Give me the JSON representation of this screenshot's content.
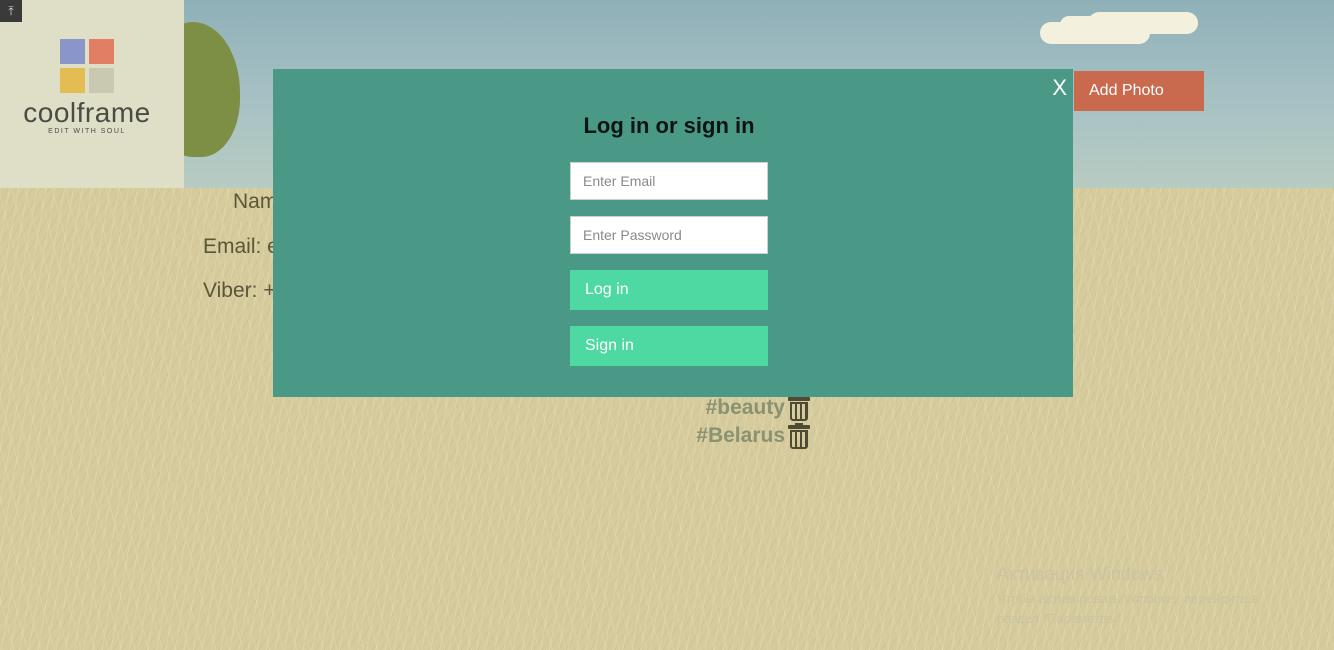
{
  "header": {
    "logo_text": "coolframe",
    "logo_tagline": "EDIT WITH SOUL",
    "upload_icon": "upload-icon",
    "add_photo_label": "Add Photo"
  },
  "profile": {
    "name_label": "Nam",
    "email_label": "Email: e",
    "viber_label": "Viber: +"
  },
  "tags": [
    {
      "text": "#beauty",
      "icon": "trash-icon"
    },
    {
      "text": "#Belarus",
      "icon": "trash-icon"
    }
  ],
  "modal": {
    "close_label": "X",
    "title": "Log in or sign in",
    "email_placeholder": "Enter Email",
    "password_placeholder": "Enter Password",
    "login_label": "Log in",
    "signin_label": "Sign in"
  },
  "watermark": {
    "title": "Активация Windows",
    "subtitle_1": "Чтобы активировать Windows, перейдите в",
    "subtitle_2": "раздел \"Параметры\"."
  },
  "colors": {
    "modal_bg": "#4a9886",
    "button_bg": "#4fd9a2",
    "add_photo_bg": "#c9694e"
  }
}
